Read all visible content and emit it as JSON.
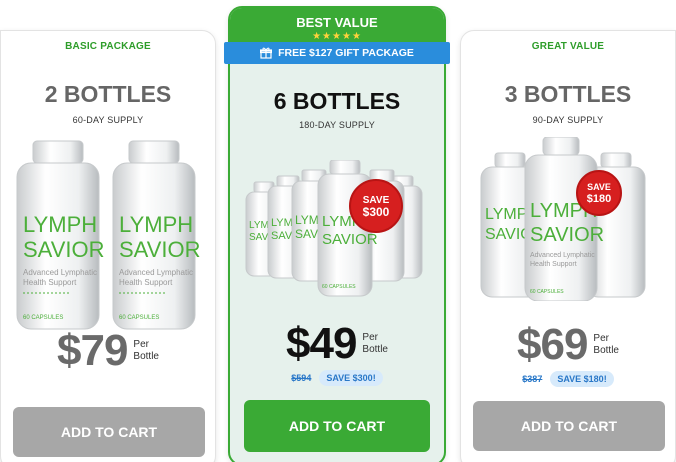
{
  "colors": {
    "brand_green": "#3aaa35",
    "ribbon_blue": "#2a8ddc",
    "save_badge_red": "#d61f1f",
    "cart_gray": "#a7a7a7"
  },
  "packages": [
    {
      "label": "BASIC PACKAGE",
      "bottles": "2 BOTTLES",
      "supply": "60-DAY SUPPLY",
      "price": "$79",
      "per_line1": "Per",
      "per_line2": "Bottle",
      "cart": "ADD TO CART",
      "bottle_brand_1": "LYMPH",
      "bottle_brand_2": "SAVIOR",
      "bottle_sub_1": "Advanced Lymphatic",
      "bottle_sub_2": "Health Support",
      "bottle_caps": "60 CAPSULES"
    },
    {
      "banner": "BEST VALUE",
      "stars": "★★★★★",
      "gift": "FREE $127 GIFT PACKAGE",
      "bottles": "6 BOTTLES",
      "supply": "180-DAY SUPPLY",
      "badge_1": "SAVE",
      "badge_2": "$300",
      "price": "$49",
      "per_line1": "Per",
      "per_line2": "Bottle",
      "old_price": "$594",
      "save": "SAVE $300!",
      "cart": "ADD TO CART",
      "bottle_brand_1": "LYMPH",
      "bottle_brand_2": "SAVIOR",
      "bottle_caps": "60 CAPSULES"
    },
    {
      "label": "GREAT VALUE",
      "bottles": "3 BOTTLES",
      "supply": "90-DAY SUPPLY",
      "badge_1": "SAVE",
      "badge_2": "$180",
      "price": "$69",
      "per_line1": "Per",
      "per_line2": "Bottle",
      "old_price": "$387",
      "save": "SAVE $180!",
      "cart": "ADD TO CART",
      "bottle_brand_1": "LYMPH",
      "bottle_brand_2": "SAVIOR",
      "bottle_sub_1": "Advanced Lymphatic",
      "bottle_sub_2": "Health Support",
      "bottle_caps": "60 CAPSULES"
    }
  ]
}
